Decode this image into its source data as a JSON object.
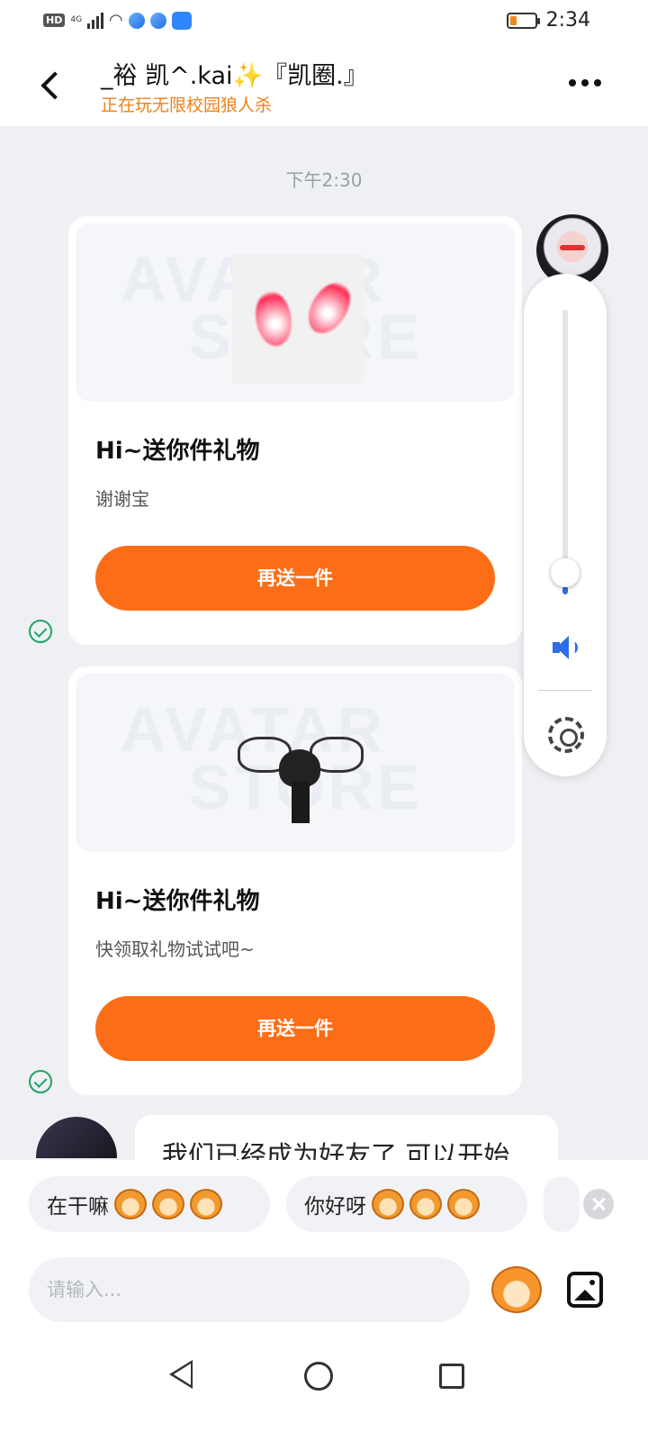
{
  "status_bar": {
    "hd": "HD",
    "network": "4G",
    "time": "2:34",
    "battery_percent": 15,
    "icons": [
      "signal-icon",
      "wifi-icon",
      "app-dot-icon",
      "app-dot-icon",
      "cloud-icon",
      "battery-icon"
    ]
  },
  "header": {
    "title": "_裕 凯^.kai✨『凯圈.』",
    "subtitle": "正在玩无限校园狼人杀",
    "back_icon": "chevron-left-icon",
    "more_icon": "more-icon"
  },
  "chat": {
    "timestamp": "下午2:30",
    "watermark_line1": "AVATAR",
    "watermark_line2": "STORE",
    "cards": [
      {
        "gift": "demon-horns",
        "title": "Hi~送你件礼物",
        "subtitle": "谢谢宝",
        "button": "再送一件"
      },
      {
        "gift": "black-bow",
        "title": "Hi~送你件礼物",
        "subtitle": "快领取礼物试试吧~",
        "button": "再送一件"
      }
    ],
    "partial_message": "我们已经成为好友了,可以开始"
  },
  "volume_panel": {
    "level_percent": 3,
    "speaker_icon": "speaker-icon",
    "settings_icon": "gear-icon"
  },
  "quick_replies": [
    {
      "text": "在干嘛",
      "emoji_count": 3
    },
    {
      "text": "你好呀",
      "emoji_count": 3
    }
  ],
  "composer": {
    "placeholder": "请输入...",
    "emoji_icon": "emoji-icon",
    "image_icon": "image-icon"
  },
  "colors": {
    "accent": "#fb6e17",
    "subtitle": "#f08218",
    "check": "#21a366",
    "volume": "#2f6ce5"
  }
}
